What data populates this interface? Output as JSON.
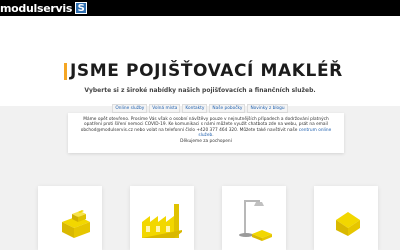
{
  "header": {
    "logo_text": "modulservis",
    "logo_mark": "S"
  },
  "hero": {
    "headline": "JSME POJIŠŤOVACÍ MAKLÉŘ",
    "subtitle": "Vyberte si z široké nabídky našich pojišťovacích a finančních služeb.",
    "nav": [
      "Online služby",
      "Volná místa",
      "Kontakty",
      "Naše pobočky",
      "Novinky z blogu"
    ]
  },
  "notice": {
    "line1": "Máme opět otevřeno. Prosíme Vás však o osobní návštěvy pouze v nejnutnějších případech a dodržování platných opatření",
    "line2": "proti šíření nemoci COVID-19. Ke komunikaci s námi můžete využít chatbota zde na webu, psát na email",
    "line3_pre": "obchod@modulservis.cz nebo volat na telefonní číslo +420 377 464 320. Můžete také navštívit naše",
    "line3_link": "centrum online služeb",
    "line4": "Děkujeme za pochopení"
  },
  "cards": [
    {
      "icon": "box-stack-icon"
    },
    {
      "icon": "factory-icon"
    },
    {
      "icon": "lamp-icon"
    },
    {
      "icon": "house-icon"
    }
  ],
  "colors": {
    "accent": "#f5a623",
    "link": "#1e5fae",
    "header_bg": "#000000",
    "page_bg": "#f1f1f1",
    "icon_yellow": "#f2d700"
  }
}
